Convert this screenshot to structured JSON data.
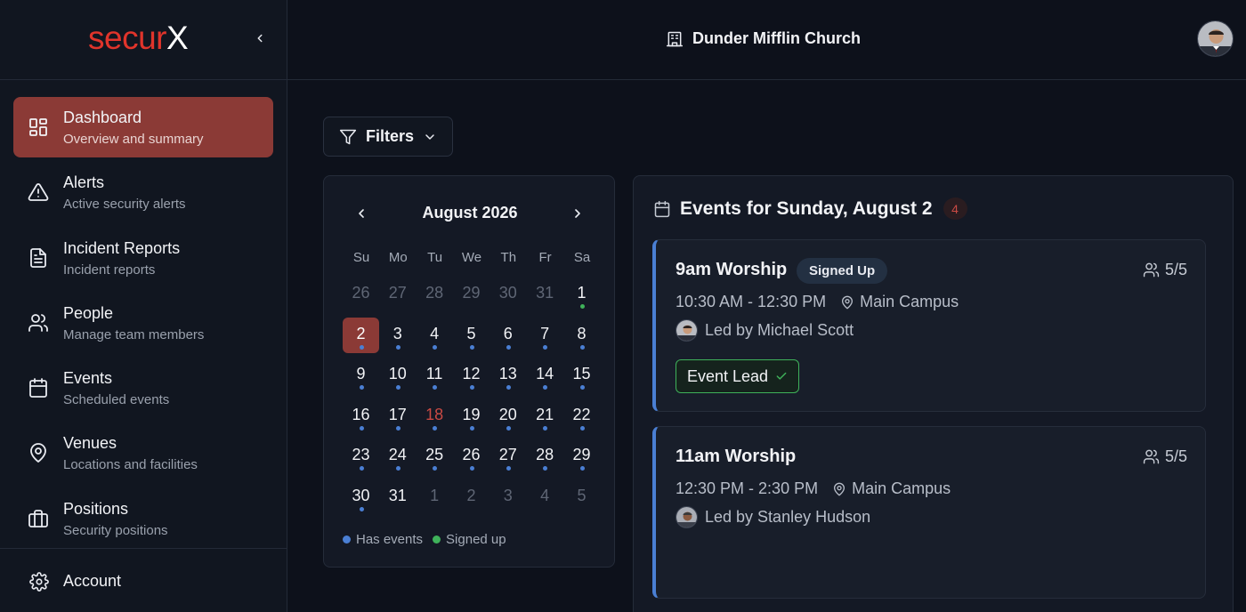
{
  "brand": {
    "part1": "secur",
    "part2": "X"
  },
  "org": {
    "name": "Dunder Mifflin Church"
  },
  "sidebar": {
    "items": [
      {
        "title": "Dashboard",
        "subtitle": "Overview and summary"
      },
      {
        "title": "Alerts",
        "subtitle": "Active security alerts"
      },
      {
        "title": "Incident Reports",
        "subtitle": "Incident reports"
      },
      {
        "title": "People",
        "subtitle": "Manage team members"
      },
      {
        "title": "Events",
        "subtitle": "Scheduled events"
      },
      {
        "title": "Venues",
        "subtitle": "Locations and facilities"
      },
      {
        "title": "Positions",
        "subtitle": "Security positions"
      }
    ],
    "account": "Account"
  },
  "filters": {
    "label": "Filters"
  },
  "calendar": {
    "month": "August 2026",
    "weekdays": [
      "Su",
      "Mo",
      "Tu",
      "We",
      "Th",
      "Fr",
      "Sa"
    ],
    "weeks": [
      [
        "26",
        "27",
        "28",
        "29",
        "30",
        "31",
        "1"
      ],
      [
        "2",
        "3",
        "4",
        "5",
        "6",
        "7",
        "8"
      ],
      [
        "9",
        "10",
        "11",
        "12",
        "13",
        "14",
        "15"
      ],
      [
        "16",
        "17",
        "18",
        "19",
        "20",
        "21",
        "22"
      ],
      [
        "23",
        "24",
        "25",
        "26",
        "27",
        "28",
        "29"
      ],
      [
        "30",
        "31",
        "1",
        "2",
        "3",
        "4",
        "5"
      ]
    ],
    "legend": {
      "has_events": "Has events",
      "signed_up": "Signed up"
    }
  },
  "events": {
    "heading": "Events for Sunday, August 2",
    "count": "4",
    "cards": [
      {
        "title": "9am Worship",
        "status": "Signed Up",
        "capacity": "5/5",
        "time": "10:30 AM - 12:30 PM",
        "location": "Main Campus",
        "led_by": "Led by Michael Scott",
        "role": "Event Lead"
      },
      {
        "title": "11am Worship",
        "capacity": "5/5",
        "time": "12:30 PM - 2:30 PM",
        "location": "Main Campus",
        "led_by": "Led by Stanley Hudson"
      }
    ]
  },
  "colors": {
    "accent": "#8b3a36",
    "brand_red": "#e0342b",
    "event_dot": "#4a7fd4",
    "signed_dot": "#3fb25a"
  }
}
